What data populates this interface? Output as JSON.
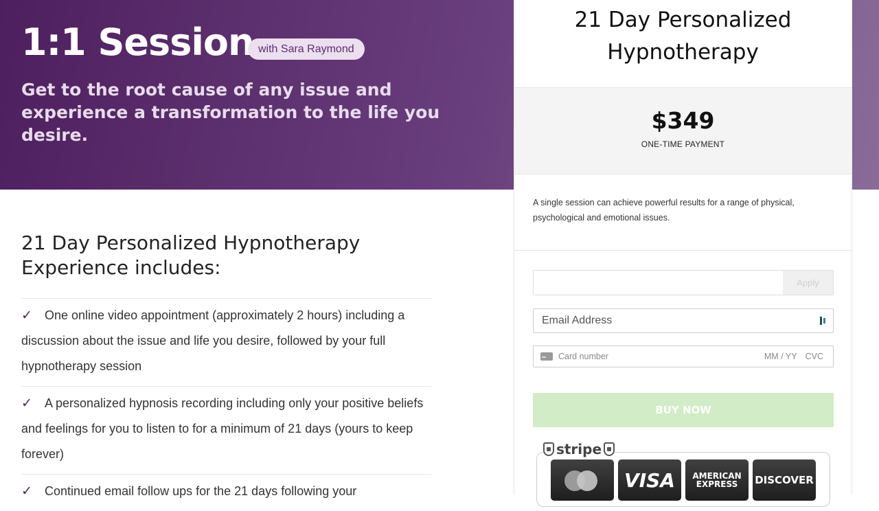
{
  "hero": {
    "title": "1:1 Session",
    "badge": "with Sara Raymond",
    "subtitle": "Get to the root cause of any issue and experience a transformation to the life you desire."
  },
  "content": {
    "heading": "21 Day Personalized Hypnotherapy Experience includes:",
    "features": [
      {
        "check": "✓",
        "text": "One online video appointment (approximately 2 hours) including a discussion about the issue and life you desire, followed by your full hypnotherapy session"
      },
      {
        "check": "✓",
        "text": "A personalized hypnosis recording including only your positive beliefs and feelings for you to listen to for a minimum of 21 days (yours to keep forever)"
      },
      {
        "check": "✓",
        "text": "Continued email follow ups for the 21 days following your"
      }
    ]
  },
  "card": {
    "title": "21 Day Personalized Hypnotherapy",
    "price": "$349",
    "price_label": "ONE-TIME PAYMENT",
    "description": "A single session can achieve powerful results for a range of physical, psychological and emotional issues.",
    "coupon": {
      "value": "",
      "apply_label": "Apply"
    },
    "email": {
      "placeholder": "Email Address"
    },
    "card_field": {
      "number_placeholder": "Card number",
      "mmyy": "MM / YY",
      "cvc": "CVC"
    },
    "buy_label": "BUY NOW",
    "badge": {
      "stripe": "stripe",
      "logos": {
        "visa": "VISA",
        "amex": "AMERICAN EXPRESS",
        "discover": "DISCOVER"
      }
    }
  },
  "colors": {
    "hero_start": "#4e1f5e",
    "hero_end": "#8a6b98",
    "buy_button": "#d1ecc7",
    "check": "#4e1f5e"
  }
}
